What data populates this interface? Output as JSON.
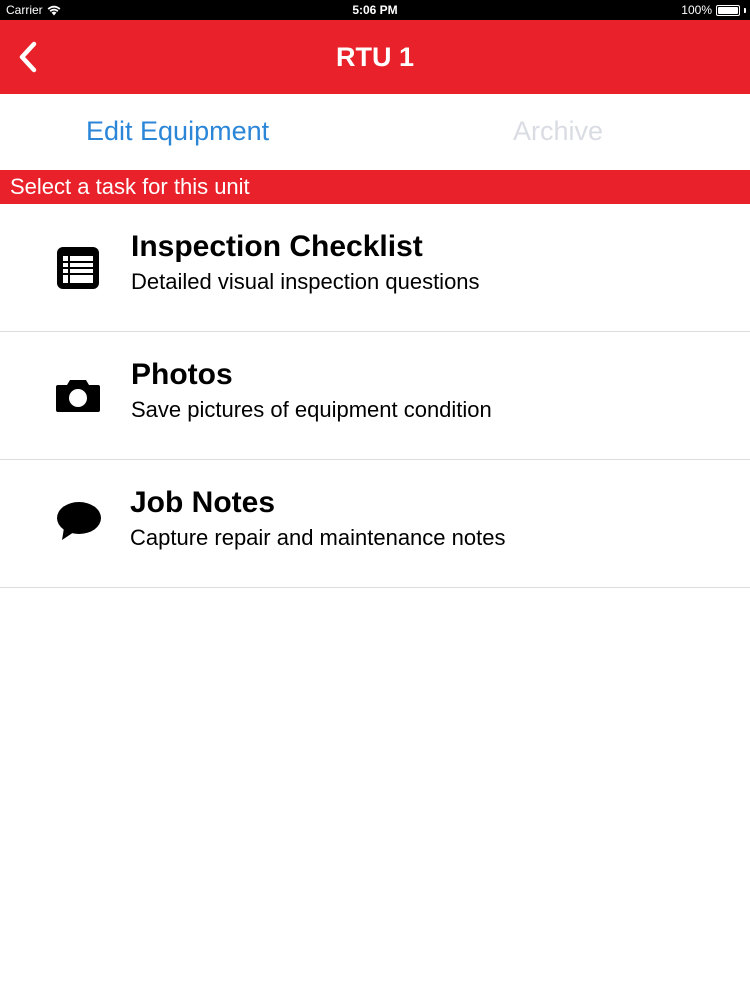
{
  "status_bar": {
    "carrier": "Carrier",
    "time": "5:06 PM",
    "battery": "100%",
    "battery_level": 1.0
  },
  "nav": {
    "title": "RTU 1"
  },
  "tabs": [
    {
      "label": "Edit Equipment"
    },
    {
      "label": "Archive"
    }
  ],
  "banner": {
    "text": "Select a task for this unit"
  },
  "tasks": [
    {
      "title": "Inspection Checklist",
      "subtitle": "Detailed visual inspection questions",
      "icon": "checklist-icon"
    },
    {
      "title": "Photos",
      "subtitle": "Save pictures of equipment condition",
      "icon": "camera-icon"
    },
    {
      "title": "Job Notes",
      "subtitle": "Capture repair and maintenance notes",
      "icon": "speech-bubble-icon"
    }
  ],
  "colors": {
    "accent": "#e8212a",
    "link": "#2b86d8",
    "disabled": "#d9dde3"
  }
}
